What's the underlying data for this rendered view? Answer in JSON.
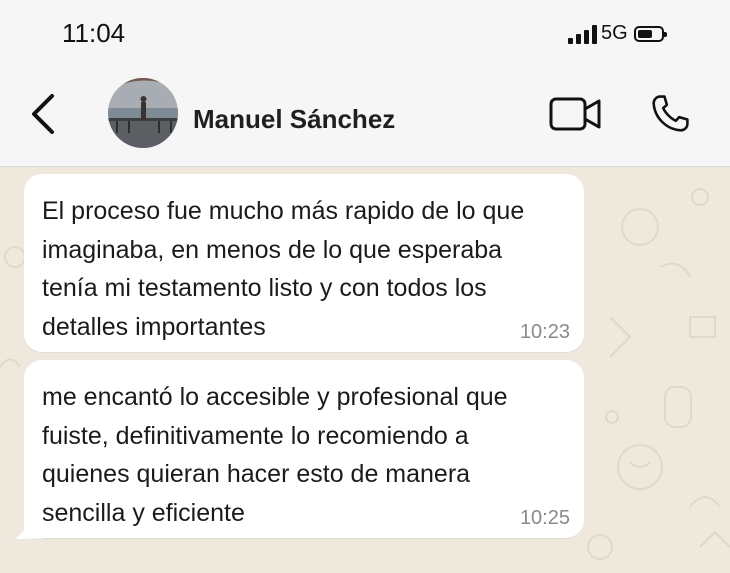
{
  "status_bar": {
    "time": "11:04",
    "network": "5G"
  },
  "header": {
    "contact_name": "Manuel Sánchez",
    "icons": [
      "back-arrow-icon",
      "video-call-icon",
      "phone-icon"
    ]
  },
  "messages": [
    {
      "text": "El proceso fue mucho más rapido de lo que imaginaba, en menos de lo que esperaba tenía mi testamento listo y con todos los detalles importantes",
      "time": "10:23"
    },
    {
      "text": "me encantó lo accesible y profesional que fuiste, definitivamente lo recomiendo a quienes quieran hacer esto de manera sencilla y eficiente",
      "time": "10:25"
    }
  ],
  "colors": {
    "chat_background": "#efe9dd",
    "bubble": "#ffffff",
    "header_background": "#f6f6f6",
    "timestamp": "#8a8a8a"
  }
}
